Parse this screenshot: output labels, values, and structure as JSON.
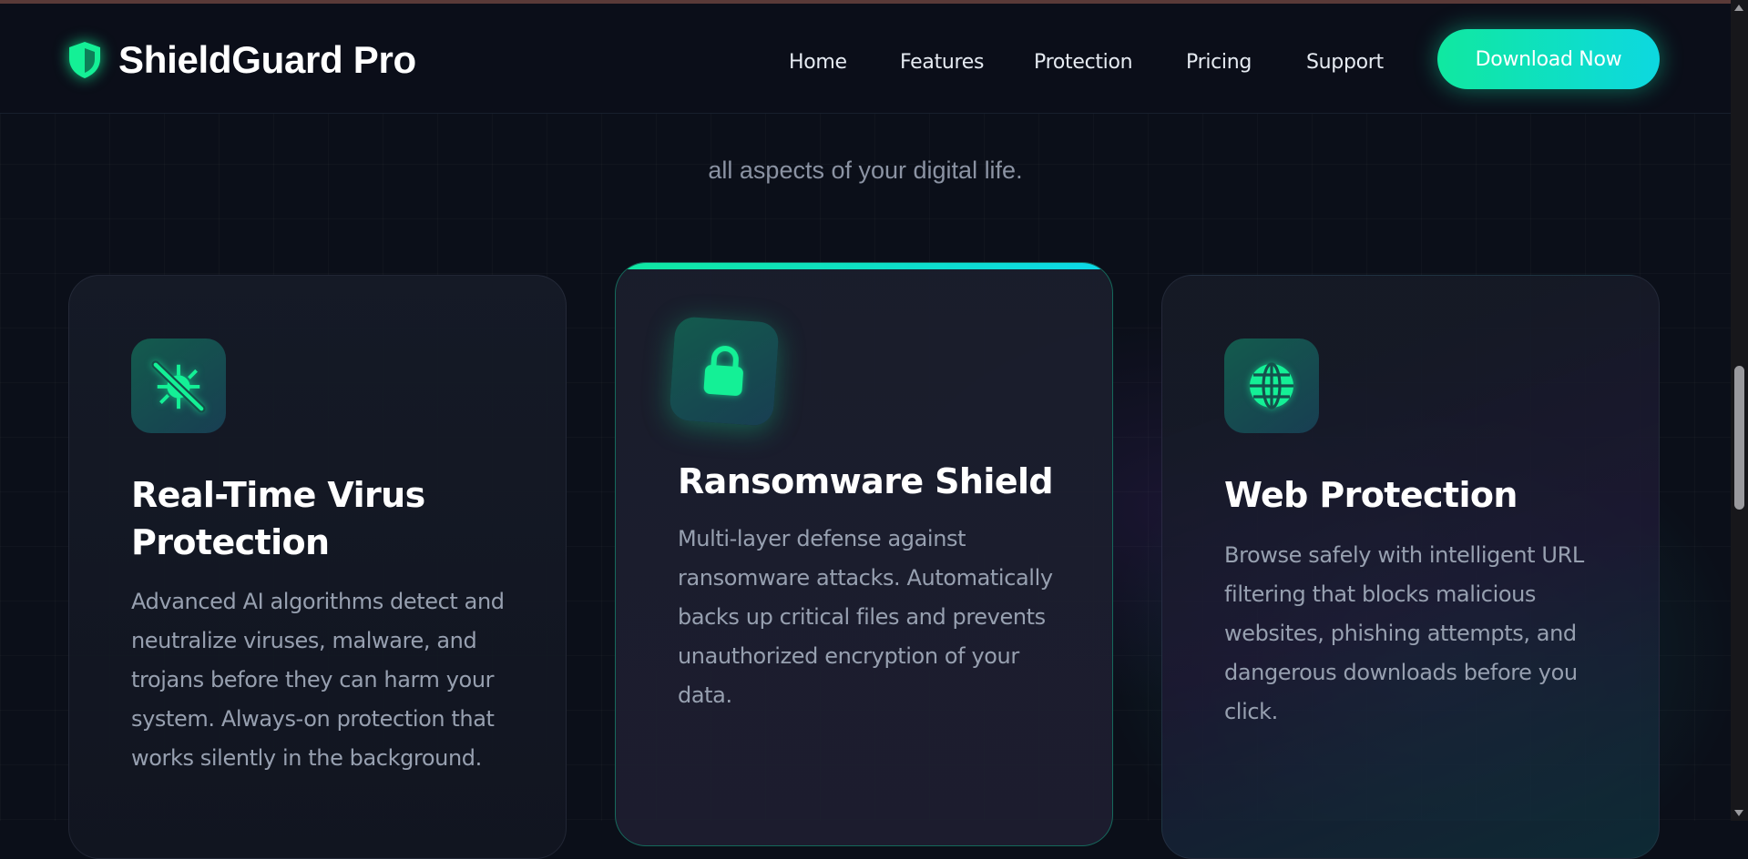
{
  "brand": {
    "name": "ShieldGuard Pro",
    "accent": "#10e8a0",
    "accent2": "#0dd8e0",
    "icon": "shield-icon"
  },
  "nav": {
    "items": [
      "Home",
      "Features",
      "Protection",
      "Pricing",
      "Support"
    ],
    "cta_label": "Download Now"
  },
  "section": {
    "subtitle": "all aspects of your digital life."
  },
  "cards": [
    {
      "icon": "virus-slash-icon",
      "title": "Real-Time Virus Protection",
      "description": "Advanced AI algorithms detect and neutralize viruses, malware, and trojans before they can harm your system. Always-on protection that works silently in the background."
    },
    {
      "icon": "lock-icon",
      "title": "Ransomware Shield",
      "description": "Multi-layer defense against ransomware attacks. Automatically backs up critical files and prevents unauthorized encryption of your data."
    },
    {
      "icon": "globe-icon",
      "title": "Web Protection",
      "description": "Browse safely with intelligent URL filtering that blocks malicious websites, phishing attempts, and dangerous downloads before you click."
    }
  ]
}
